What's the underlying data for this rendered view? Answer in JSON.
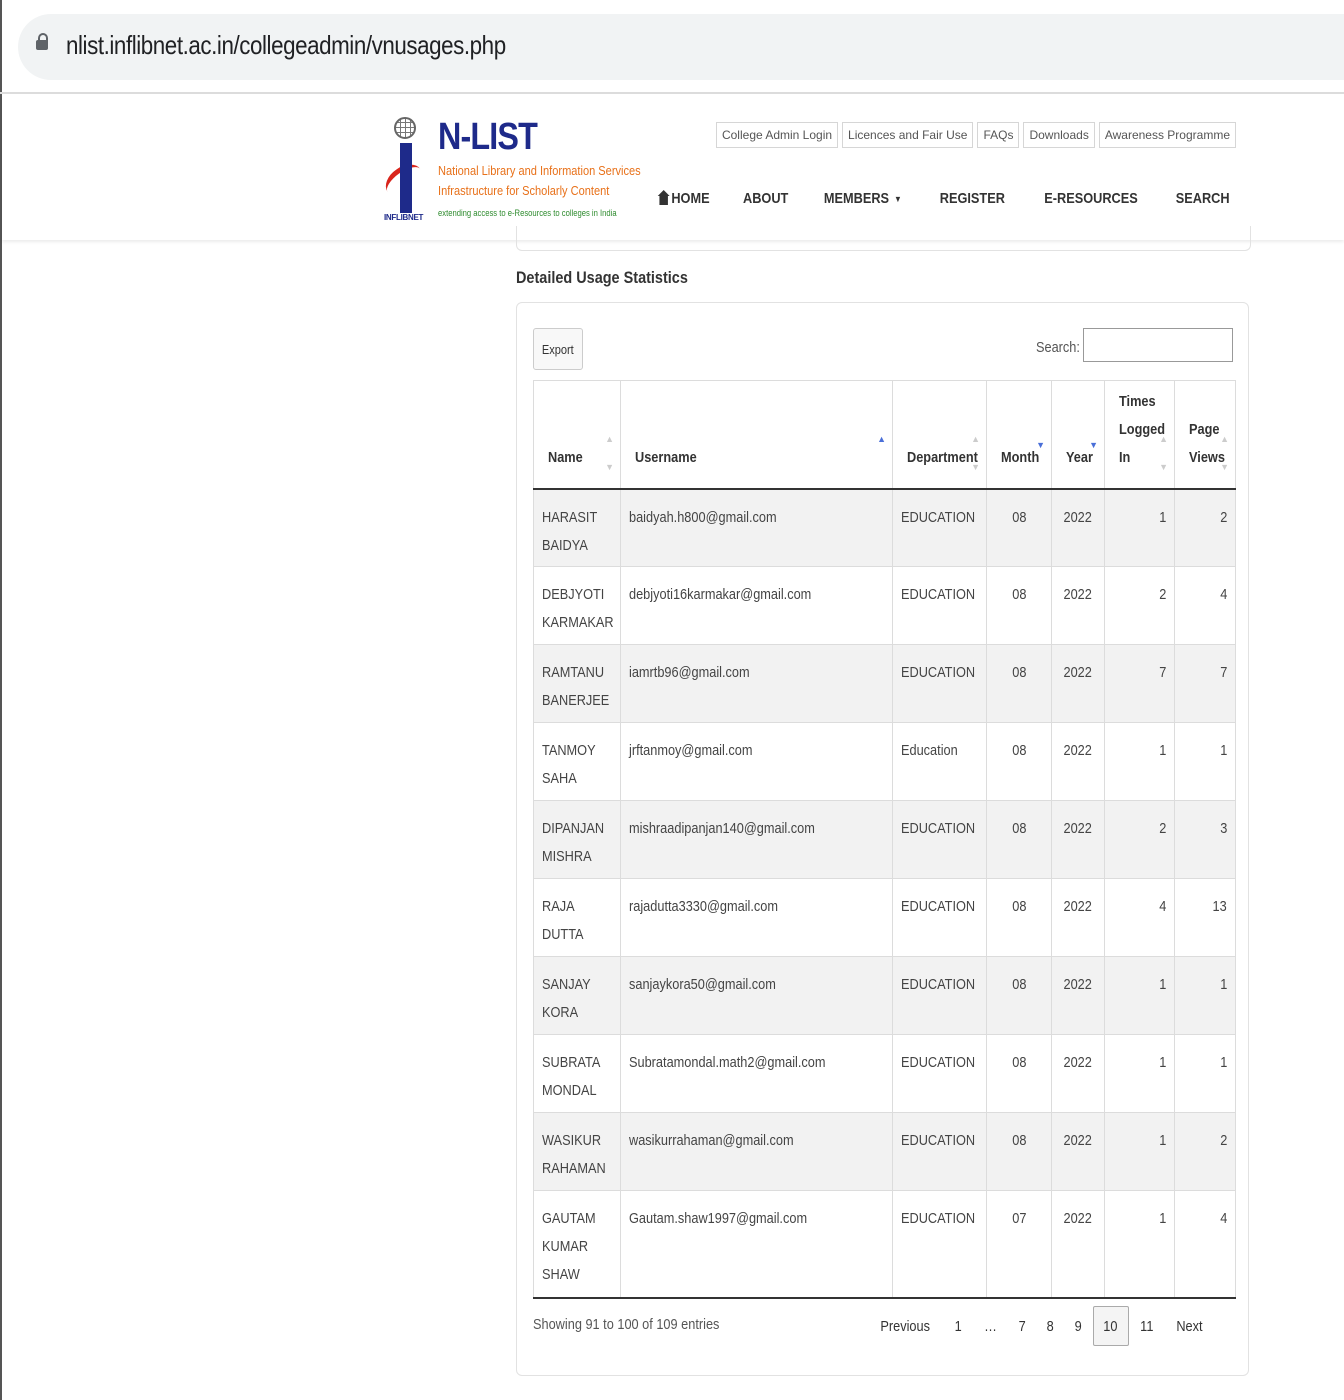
{
  "browser": {
    "url": "nlist.inflibnet.ac.in/collegeadmin/vnusages.php"
  },
  "logo": {
    "title": "N-LIST",
    "line1": "National Library and Information Services",
    "line2": "Infrastructure for Scholarly Content",
    "line3": "extending access to e-Resources to colleges in India",
    "inflibnet": "INFLIBNET"
  },
  "toplinks": [
    "College Admin Login",
    "Licences and Fair Use",
    "FAQs",
    "Downloads",
    "Awareness Programme"
  ],
  "nav": {
    "home": "HOME",
    "about": "ABOUT",
    "members": "MEMBERS",
    "register": "REGISTER",
    "eresources": "E-RESOURCES",
    "search": "SEARCH"
  },
  "section_title": "Detailed Usage Statistics",
  "toolbar": {
    "export": "Export",
    "search_label": "Search:",
    "search_value": ""
  },
  "columns": {
    "name": "Name",
    "username": "Username",
    "department": "Department",
    "month": "Month",
    "year": "Year",
    "times_logged_in": [
      "Times",
      "Logged",
      "In"
    ],
    "page_views": [
      "Page",
      "Views"
    ]
  },
  "rows": [
    {
      "name": [
        "HARASIT",
        "BAIDYA"
      ],
      "username": "baidyah.h800@gmail.com",
      "dept": "EDUCATION",
      "month": "08",
      "year": "2022",
      "logins": "1",
      "views": "2"
    },
    {
      "name": [
        "DEBJYOTI",
        "KARMAKAR"
      ],
      "username": "debjyoti16karmakar@gmail.com",
      "dept": "EDUCATION",
      "month": "08",
      "year": "2022",
      "logins": "2",
      "views": "4"
    },
    {
      "name": [
        "RAMTANU",
        "BANERJEE"
      ],
      "username": "iamrtb96@gmail.com",
      "dept": "EDUCATION",
      "month": "08",
      "year": "2022",
      "logins": "7",
      "views": "7"
    },
    {
      "name": [
        "TANMOY",
        "SAHA"
      ],
      "username": "jrftanmoy@gmail.com",
      "dept": "Education",
      "month": "08",
      "year": "2022",
      "logins": "1",
      "views": "1"
    },
    {
      "name": [
        "DIPANJAN",
        "MISHRA"
      ],
      "username": "mishraadipanjan140@gmail.com",
      "dept": "EDUCATION",
      "month": "08",
      "year": "2022",
      "logins": "2",
      "views": "3"
    },
    {
      "name": [
        "RAJA",
        "DUTTA"
      ],
      "username": "rajadutta3330@gmail.com",
      "dept": "EDUCATION",
      "month": "08",
      "year": "2022",
      "logins": "4",
      "views": "13"
    },
    {
      "name": [
        "SANJAY",
        "KORA"
      ],
      "username": "sanjaykora50@gmail.com",
      "dept": "EDUCATION",
      "month": "08",
      "year": "2022",
      "logins": "1",
      "views": "1"
    },
    {
      "name": [
        "SUBRATA",
        "MONDAL"
      ],
      "username": "Subratamondal.math2@gmail.com",
      "dept": "EDUCATION",
      "month": "08",
      "year": "2022",
      "logins": "1",
      "views": "1"
    },
    {
      "name": [
        "WASIKUR",
        "RAHAMAN"
      ],
      "username": "wasikurrahaman@gmail.com",
      "dept": "EDUCATION",
      "month": "08",
      "year": "2022",
      "logins": "1",
      "views": "2"
    },
    {
      "name": [
        "GAUTAM",
        "KUMAR",
        "SHAW"
      ],
      "username": "Gautam.shaw1997@gmail.com",
      "dept": "EDUCATION",
      "month": "07",
      "year": "2022",
      "logins": "1",
      "views": "4"
    }
  ],
  "footer": {
    "info": "Showing 91 to 100 of 109 entries"
  },
  "pagination": {
    "previous": "Previous",
    "next": "Next",
    "ellipsis": "…",
    "pages": [
      "1",
      "7",
      "8",
      "9",
      "10",
      "11"
    ],
    "current": "10"
  },
  "icons": {
    "lock": "lock-icon",
    "home": "home-icon",
    "caret": "caret-down-icon"
  },
  "colors": {
    "brand_blue": "#1e2a8a",
    "brand_orange": "#e8711a",
    "sort_active": "#4a6fd8"
  }
}
